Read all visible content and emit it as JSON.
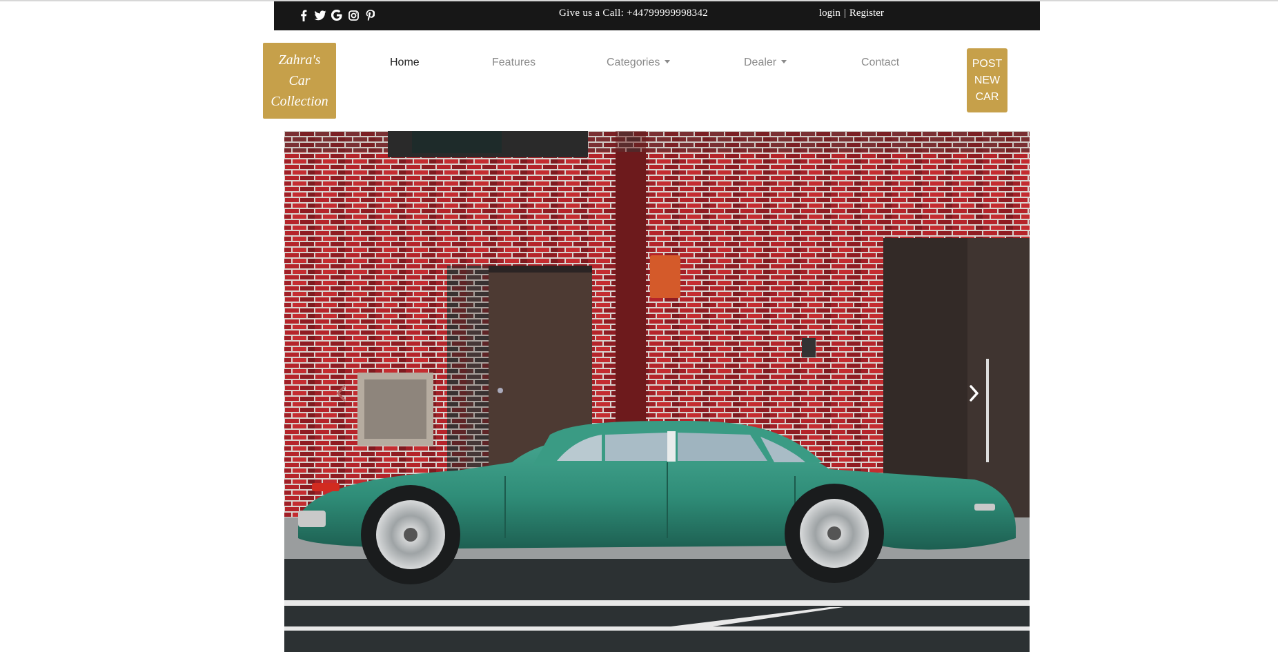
{
  "topbar": {
    "socials": [
      {
        "icon": "facebook-icon"
      },
      {
        "icon": "twitter-icon"
      },
      {
        "icon": "google-icon"
      },
      {
        "icon": "instagram-icon"
      },
      {
        "icon": "pinterest-icon"
      }
    ],
    "call_text": "Give us a Call: +44799999998342",
    "login_label": "login",
    "separator": "|",
    "register_label": "Register"
  },
  "nav": {
    "brand": "Zahra's Car Collection",
    "items": [
      {
        "label": "Home",
        "active": true
      },
      {
        "label": "Features",
        "active": false
      },
      {
        "label": "Categories",
        "active": false,
        "dropdown": true
      },
      {
        "label": "Dealer",
        "active": false,
        "dropdown": true
      },
      {
        "label": "Contact",
        "active": false
      }
    ],
    "post_button": "POST NEW CAR"
  },
  "hero": {
    "image": "green classic sedan parked in front of red brick wall",
    "prev_icon": "chevron-left-icon",
    "next_icon": "chevron-right-icon"
  },
  "colors": {
    "topbar_bg": "#171717",
    "accent": "#c6a04a",
    "nav_text": "#8a8a8a",
    "nav_active": "#222222"
  }
}
